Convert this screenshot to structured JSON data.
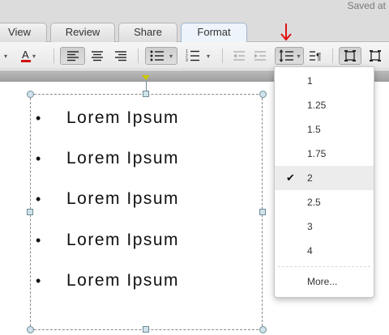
{
  "header": {
    "saved_status": "Saved at"
  },
  "tabs": [
    {
      "label": "View"
    },
    {
      "label": "Review"
    },
    {
      "label": "Share"
    },
    {
      "label": "Format"
    }
  ],
  "active_tab": "Format",
  "document": {
    "bullets": [
      "Lorem Ipsum",
      "Lorem Ipsum",
      "Lorem Ipsum",
      "Lorem Ipsum",
      "Lorem Ipsum"
    ],
    "bullet_glyph": "•"
  },
  "line_spacing_menu": {
    "options": [
      "1",
      "1.25",
      "1.5",
      "1.75",
      "2",
      "2.5",
      "3",
      "4"
    ],
    "selected": "2",
    "more_label": "More..."
  },
  "colors": {
    "annotation_arrow": "#e01010",
    "font_color_underline": "#d01010",
    "active_tab_border": "#9fb6cf"
  },
  "icons": [
    "font-color-icon",
    "align-left-icon",
    "align-center-icon",
    "align-right-icon",
    "bullet-list-icon",
    "numbered-list-icon",
    "decrease-indent-icon",
    "increase-indent-icon",
    "line-spacing-icon",
    "paragraph-mark-icon",
    "text-box-icon",
    "checkmark-icon"
  ]
}
